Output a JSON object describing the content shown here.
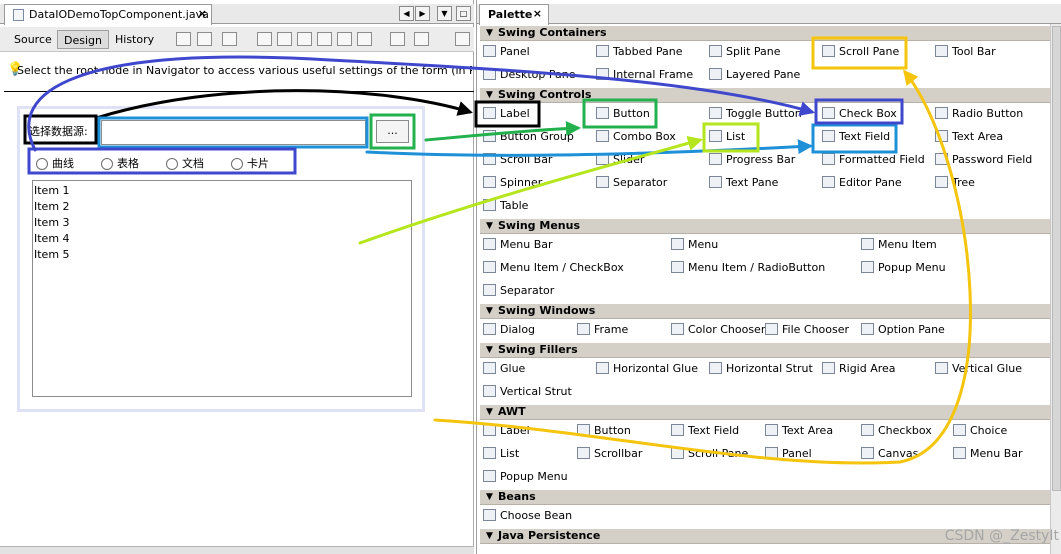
{
  "editor": {
    "tab_title": "DataIODemoTopComponent.java",
    "close_glyph": "×",
    "modes": [
      "Source",
      "Design",
      "History"
    ],
    "hint": "Select the root node in Navigator to access various useful settings of the form (in Properties window)",
    "form": {
      "source_label": "选择数据源:",
      "source_value": "",
      "browse_label": "...",
      "radios": [
        "曲线",
        "表格",
        "文档",
        "卡片"
      ],
      "list_items": [
        "Item 1",
        "Item 2",
        "Item 3",
        "Item 4",
        "Item 5"
      ]
    }
  },
  "palette": {
    "tab_title": "Palette",
    "close_glyph": "×",
    "categories": [
      {
        "title": "Swing Containers",
        "items": [
          "Panel",
          "Tabbed Pane",
          "Split Pane",
          "Scroll Pane",
          "Tool Bar",
          "Desktop Pane",
          "Internal Frame",
          "Layered Pane"
        ]
      },
      {
        "title": "Swing Controls",
        "items": [
          "Label",
          "Button",
          "Toggle Button",
          "Check Box",
          "Radio Button",
          "Button Group",
          "Combo Box",
          "List",
          "Text Field",
          "Text Area",
          "Scroll Bar",
          "Slider",
          "Progress Bar",
          "Formatted Field",
          "Password Field",
          "Spinner",
          "Separator",
          "Text Pane",
          "Editor Pane",
          "Tree",
          "Table"
        ]
      },
      {
        "title": "Swing Menus",
        "items": [
          "Menu Bar",
          "Menu",
          "Menu Item",
          "Menu Item / CheckBox",
          "Menu Item / RadioButton",
          "Popup Menu",
          "Separator"
        ]
      },
      {
        "title": "Swing Windows",
        "items": [
          "Dialog",
          "Frame",
          "Color Chooser",
          "File Chooser",
          "Option Pane"
        ]
      },
      {
        "title": "Swing Fillers",
        "items": [
          "Glue",
          "Horizontal Glue",
          "Horizontal Strut",
          "Rigid Area",
          "Vertical Glue",
          "Vertical Strut"
        ]
      },
      {
        "title": "AWT",
        "items": [
          "Label",
          "Button",
          "Text Field",
          "Text Area",
          "Checkbox",
          "Choice",
          "List",
          "Scrollbar",
          "Scroll Pane",
          "Panel",
          "Canvas",
          "Menu Bar",
          "Popup Menu"
        ]
      },
      {
        "title": "Beans",
        "items": [
          "Choose Bean"
        ]
      },
      {
        "title": "Java Persistence",
        "items": []
      }
    ]
  },
  "watermark": "CSDN @_ZestyIt",
  "colors": {
    "annotation_black": "#000000",
    "annotation_green": "#22b14c",
    "annotation_blue": "#1e90d8",
    "annotation_navy": "#3f48cc",
    "annotation_lime": "#b5e61d",
    "annotation_yellow": "#f5c40c"
  }
}
